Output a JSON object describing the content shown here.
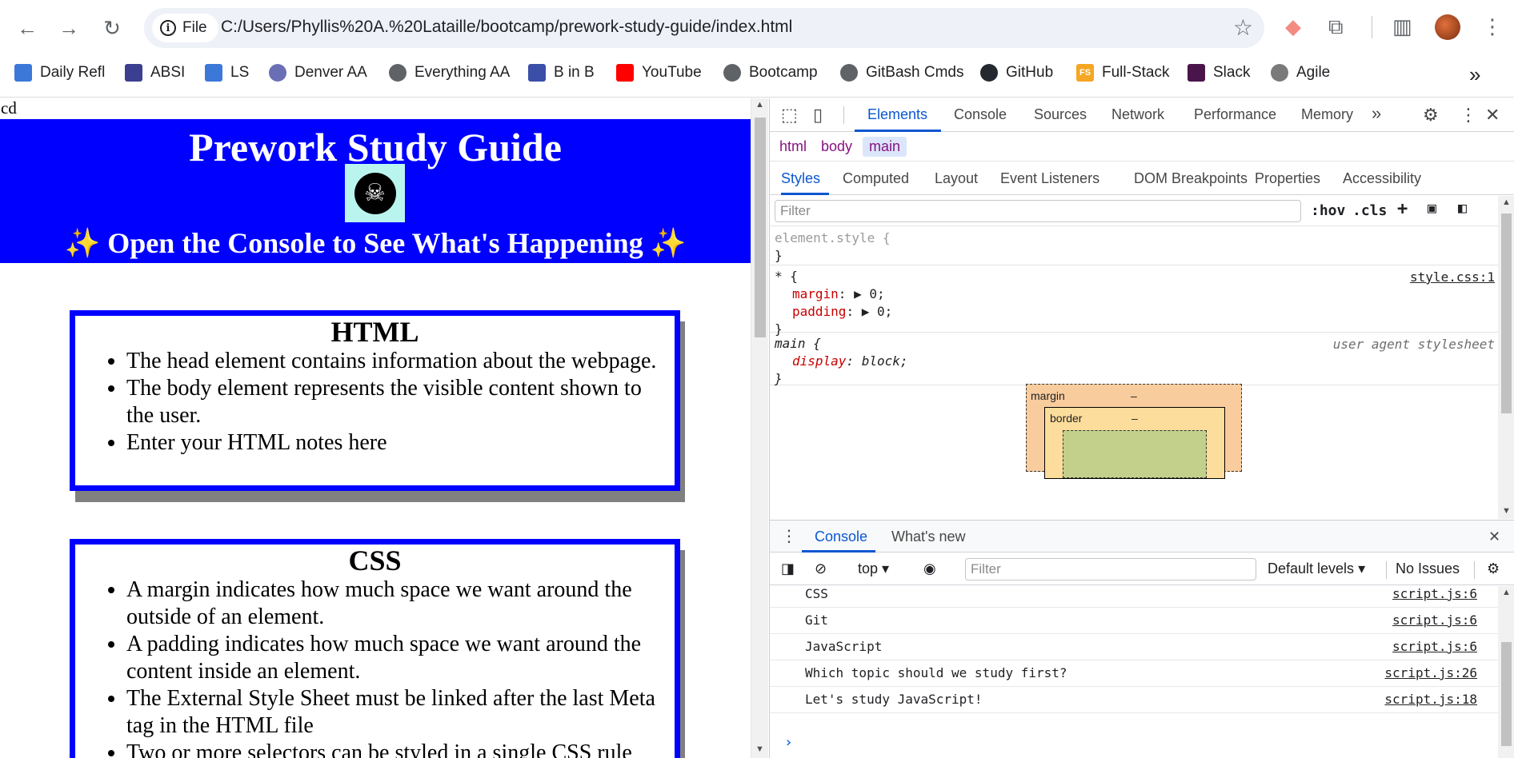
{
  "browser": {
    "site_chip": "File",
    "url": "C:/Users/Phyllis%20A.%20Lataille/bootcamp/prework-study-guide/index.html",
    "icons": {
      "back": "arrow-left-icon",
      "forward": "arrow-right-icon",
      "reload": "reload-icon",
      "star": "star-icon",
      "extensions": "puzzle-icon",
      "side_panel": "side-panel-icon",
      "menu": "kebab-menu-icon"
    },
    "glyphs": {
      "back": "←",
      "forward": "→",
      "reload": "↻",
      "star": "☆",
      "cast": "◆",
      "extensions": "⧉",
      "side_panel": "▥",
      "menu": "⋮"
    }
  },
  "bookmarks": [
    {
      "label": "Daily Refl",
      "color": "#3c78d8",
      "kind": "square"
    },
    {
      "label": "ABSI",
      "color": "#3b3f8f",
      "kind": "square"
    },
    {
      "label": "LS",
      "color": "#3c78d8",
      "kind": "square"
    },
    {
      "label": "Denver AA",
      "color": "#6a6fb5",
      "kind": "globe"
    },
    {
      "label": "Everything AA",
      "color": "#5f6368",
      "kind": "globe"
    },
    {
      "label": "B in B",
      "color": "#3b4ea8",
      "kind": "square"
    },
    {
      "label": "YouTube",
      "color": "#ff0000",
      "kind": "square"
    },
    {
      "label": "Bootcamp",
      "color": "#5f6368",
      "kind": "globe"
    },
    {
      "label": "GitBash Cmds",
      "color": "#5f6368",
      "kind": "globe"
    },
    {
      "label": "GitHub",
      "color": "#24292f",
      "kind": "globe"
    },
    {
      "label": "Full-Stack",
      "color": "#f5a623",
      "kind": "square",
      "text": "FS"
    },
    {
      "label": "Slack",
      "color": "#4a154b",
      "kind": "square"
    },
    {
      "label": "Agile",
      "color": "#7a7a7a",
      "kind": "globe"
    }
  ],
  "bookmarks_more": "»",
  "page": {
    "stray_text": "cd",
    "title": "Prework Study Guide",
    "logo_glyph": "☠",
    "subtitle": "✨ Open the Console to See What's Happening ✨",
    "sections": [
      {
        "heading": "HTML",
        "items": [
          "The head element contains information about the webpage.",
          "The body element represents the visible content shown to the user.",
          "Enter your HTML notes here"
        ]
      },
      {
        "heading": "CSS",
        "items": [
          "A margin indicates how much space we want around the outside of an element.",
          "A padding indicates how much space we want around the content inside an element.",
          "The External Style Sheet must be linked after the last Meta tag in the HTML file",
          "Two or more selectors can be styled in a single CSS rule"
        ]
      }
    ]
  },
  "devtools": {
    "tabs": [
      "Elements",
      "Console",
      "Sources",
      "Network",
      "Performance",
      "Memory"
    ],
    "active_tab": "Elements",
    "more_tabs": "»",
    "breadcrumbs": [
      "html",
      "body",
      "main"
    ],
    "subtabs": [
      "Styles",
      "Computed",
      "Layout",
      "Event Listeners",
      "DOM Breakpoints",
      "Properties",
      "Accessibility"
    ],
    "filter_placeholder": "Filter",
    "hov": ":hov",
    "cls": ".cls",
    "rules": {
      "element_style": {
        "selector": "element.style {",
        "close": "}"
      },
      "universal": {
        "selector": "* {",
        "source": "style.css:1",
        "decls": [
          {
            "prop": "margin",
            "value": "0;"
          },
          {
            "prop": "padding",
            "value": "0;"
          }
        ],
        "close": "}"
      },
      "main": {
        "selector": "main {",
        "source": "user agent stylesheet",
        "decls": [
          {
            "prop": "display",
            "value": "block;"
          }
        ],
        "close": "}"
      }
    },
    "box_model": {
      "margin_label": "margin",
      "margin_value": "–",
      "border_label": "border",
      "border_value": "–"
    },
    "drawer": {
      "tabs": [
        "Console",
        "What's new"
      ],
      "context": "top",
      "filter_placeholder": "Filter",
      "levels": "Default levels",
      "issues": "No Issues",
      "logs": [
        {
          "msg": "CSS",
          "src": "script.js:6"
        },
        {
          "msg": "Git",
          "src": "script.js:6"
        },
        {
          "msg": "JavaScript",
          "src": "script.js:6"
        },
        {
          "msg": "Which topic should we study first?",
          "src": "script.js:26"
        },
        {
          "msg": "Let's study JavaScript!",
          "src": "script.js:18"
        }
      ],
      "prompt": "›"
    }
  }
}
